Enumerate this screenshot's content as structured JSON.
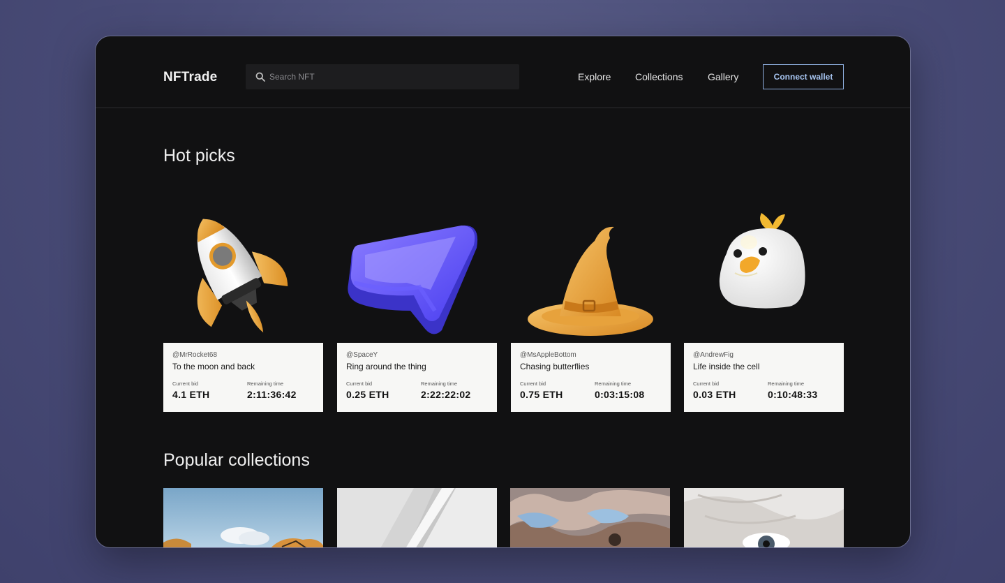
{
  "app": {
    "logo": "NFTrade"
  },
  "search": {
    "placeholder": "Search NFT"
  },
  "nav": {
    "items": [
      "Explore",
      "Collections",
      "Gallery"
    ],
    "connect_label": "Connect wallet"
  },
  "hot_picks": {
    "title": "Hot picks",
    "bid_label": "Current bid",
    "time_label": "Remaining time",
    "items": [
      {
        "handle": "@MrRocket68",
        "title": "To the moon and back",
        "bid": "4.1 ETH",
        "time": "2:11:36:42",
        "art": "rocket"
      },
      {
        "handle": "@SpaceY",
        "title": "Ring around the thing",
        "bid": "0.25 ETH",
        "time": "2:22:22:02",
        "art": "purple-shape"
      },
      {
        "handle": "@MsAppleBottom",
        "title": "Chasing butterflies",
        "bid": "0.75 ETH",
        "time": "0:03:15:08",
        "art": "witch-hat"
      },
      {
        "handle": "@AndrewFig",
        "title": "Life inside the cell",
        "bid": "0.03 ETH",
        "time": "0:10:48:33",
        "art": "white-bird"
      }
    ]
  },
  "popular": {
    "title": "Popular collections",
    "items": [
      "landscape-collection",
      "white-abstract-collection",
      "fabric-collection",
      "eye-collection"
    ]
  },
  "colors": {
    "accent": "#a8c6f2",
    "card_bg": "#f7f7f5",
    "window_bg": "#111112",
    "page_bg": "#4a4d78"
  }
}
